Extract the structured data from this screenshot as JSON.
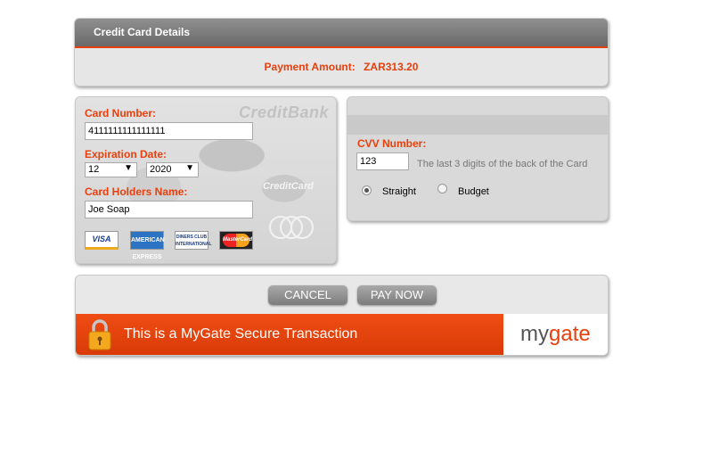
{
  "header": {
    "title": "Credit Card Details",
    "payment_label": "Payment Amount:",
    "payment_value": "ZAR313.20"
  },
  "card_form": {
    "brand_logo_text": "CreditBank",
    "card_logo_text": "CreditCard",
    "card_number_label": "Card Number:",
    "card_number_value": "4111111111111111",
    "expiration_label": "Expiration Date:",
    "exp_month": "12",
    "exp_year": "2020",
    "holder_label": "Card Holders Name:",
    "holder_value": "Joe Soap",
    "card_logos": [
      "VISA",
      "AMERICAN EXPRESS",
      "DINERS CLUB INTERNATIONAL",
      "MasterCard"
    ]
  },
  "cvv": {
    "label": "CVV Number:",
    "value": "123",
    "hint": "The last 3 digits of the back of the Card",
    "option_straight": "Straight",
    "option_budget": "Budget",
    "selected": "Straight"
  },
  "actions": {
    "cancel_label": "CANCEL",
    "paynow_label": "PAY NOW"
  },
  "secure_bar": {
    "text": "This is a MyGate Secure Transaction",
    "logo_my": "my",
    "logo_gate": "gate"
  },
  "colors": {
    "accent": "#e8400c",
    "header_gray": "#7a7a7a"
  }
}
